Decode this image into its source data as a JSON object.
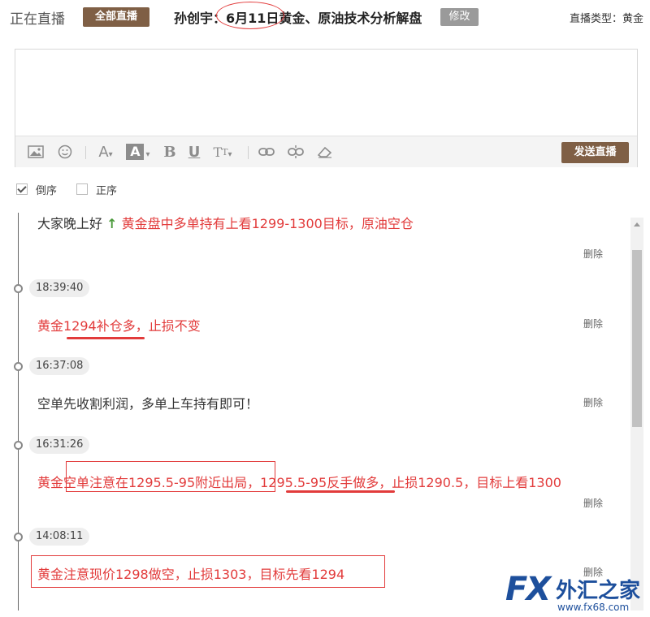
{
  "header": {
    "live_title": "正在直播",
    "all_button": "全部直播",
    "topic_title": "孙创宇：6月11日黄金、原油技术分析解盘",
    "edit_button": "修改",
    "type_label": "直播类型：黄金"
  },
  "editor": {
    "text": "",
    "send_button": "发送直播",
    "tools": [
      "image-icon",
      "emoji-icon",
      "font-size-icon",
      "font-color-icon",
      "bold-icon",
      "underline-icon",
      "font-family-icon",
      "link-icon",
      "unlink-icon",
      "eraser-icon"
    ]
  },
  "order": {
    "desc_label": "倒序",
    "asc_label": "正序",
    "desc_checked": true
  },
  "feed": {
    "delete_label": "删除",
    "entries": [
      {
        "time": "",
        "text_a": "大家晚上好",
        "text_b": "黄金盘中多单持有上看1299-1300目标，原油空仓"
      },
      {
        "time": "18:39:40",
        "text": "黄金1294补仓多，止损不变"
      },
      {
        "time": "16:37:08",
        "text": "空单先收割利润，多单上车持有即可！"
      },
      {
        "time": "16:31:26",
        "text": "黄金空单注意在1295.5-95附近出局，1295.5-95反手做多，止损1290.5，目标上看1300"
      },
      {
        "time": "14:08:11",
        "text": "黄金注意现价1298做空，止损1303，目标先看1294"
      }
    ]
  },
  "watermark": {
    "fx": "FX",
    "name": "外汇之家",
    "url": "www.fx68.com"
  },
  "colors": {
    "brand_brown": "#7f5f45",
    "alert_red": "#e23b3b",
    "watermark_blue": "#1d4f9c"
  }
}
